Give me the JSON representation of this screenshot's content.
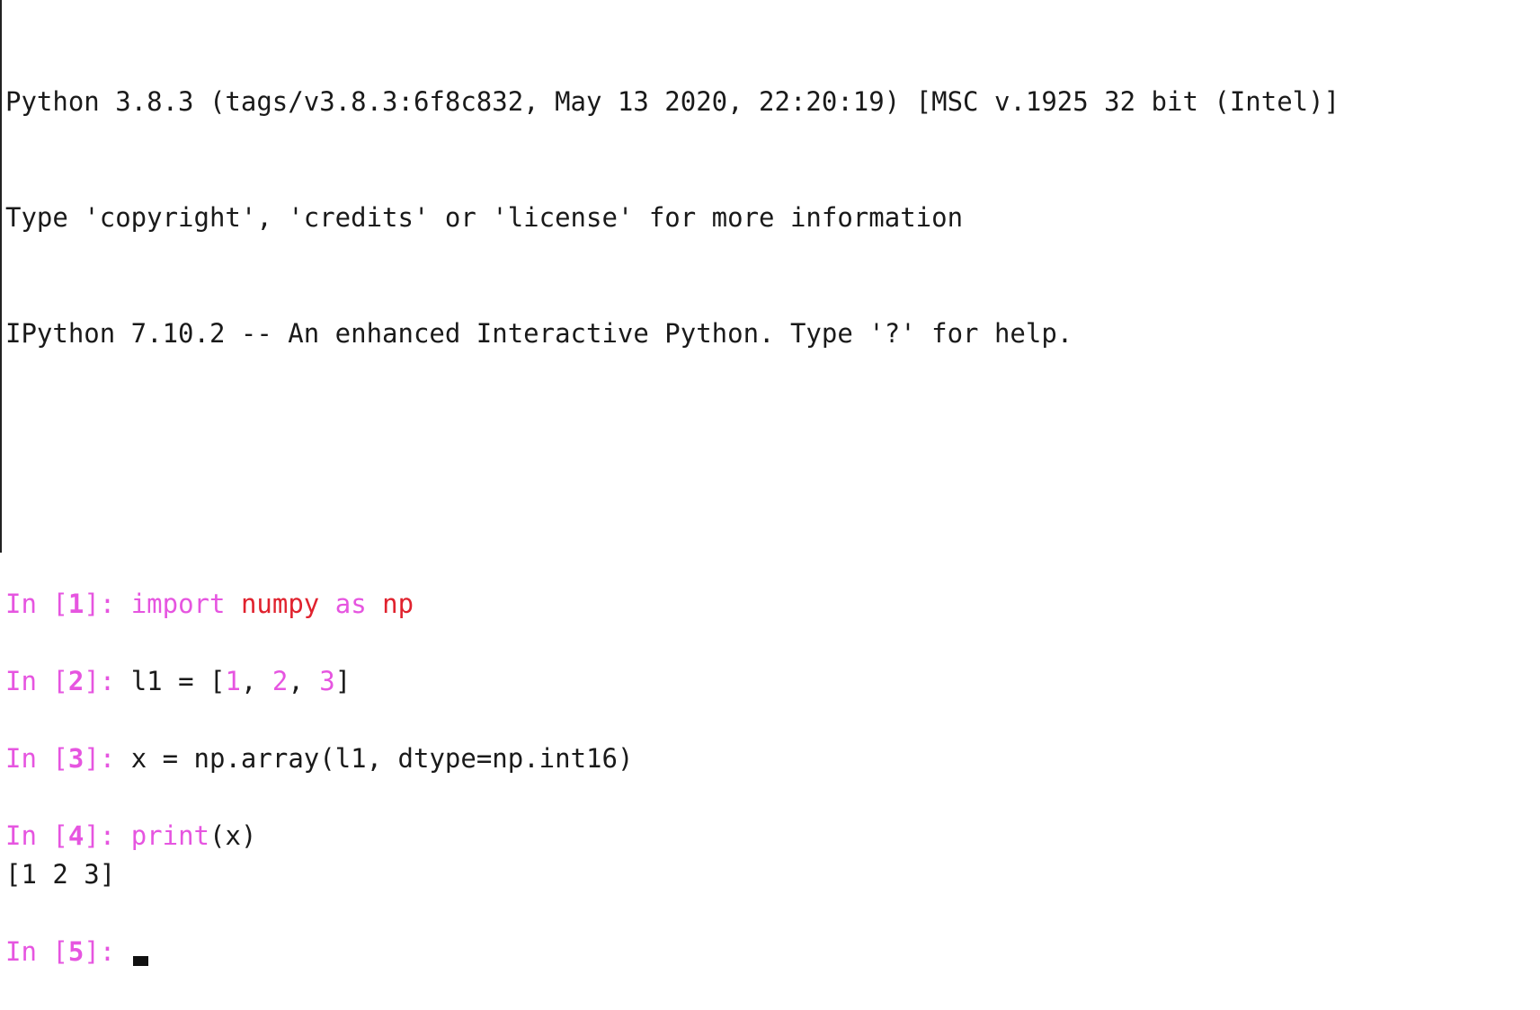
{
  "banner": {
    "line1": "Python 3.8.3 (tags/v3.8.3:6f8c832, May 13 2020, 22:20:19) [MSC v.1925 32 bit (Intel)]",
    "line2": "Type 'copyright', 'credits' or 'license' for more information",
    "line3": "IPython 7.10.2 -- An enhanced Interactive Python. Type '?' for help."
  },
  "prompt": {
    "in_label": "In ",
    "open_bracket": "[",
    "close_bracket": "]: "
  },
  "cells": [
    {
      "number": "1",
      "tokens": [
        {
          "text": "import",
          "kind": "kw"
        },
        {
          "text": " ",
          "kind": "plain"
        },
        {
          "text": "numpy",
          "kind": "mod"
        },
        {
          "text": " ",
          "kind": "plain"
        },
        {
          "text": "as",
          "kind": "kw"
        },
        {
          "text": " ",
          "kind": "plain"
        },
        {
          "text": "np",
          "kind": "mod"
        }
      ]
    },
    {
      "number": "2",
      "tokens": [
        {
          "text": "l1 = [",
          "kind": "plain"
        },
        {
          "text": "1",
          "kind": "num"
        },
        {
          "text": ", ",
          "kind": "plain"
        },
        {
          "text": "2",
          "kind": "num"
        },
        {
          "text": ", ",
          "kind": "plain"
        },
        {
          "text": "3",
          "kind": "num"
        },
        {
          "text": "]",
          "kind": "plain"
        }
      ]
    },
    {
      "number": "3",
      "tokens": [
        {
          "text": "x = np.array(l1, dtype=np.int16)",
          "kind": "plain"
        }
      ]
    },
    {
      "number": "4",
      "tokens": [
        {
          "text": "print",
          "kind": "kw"
        },
        {
          "text": "(x)",
          "kind": "plain"
        }
      ],
      "output": "[1 2 3]"
    },
    {
      "number": "5",
      "tokens": [],
      "active": true
    }
  ],
  "colors": {
    "prompt": "#e655e0",
    "module": "#e0222e",
    "text": "#1a1a1a",
    "background": "#ffffff"
  }
}
